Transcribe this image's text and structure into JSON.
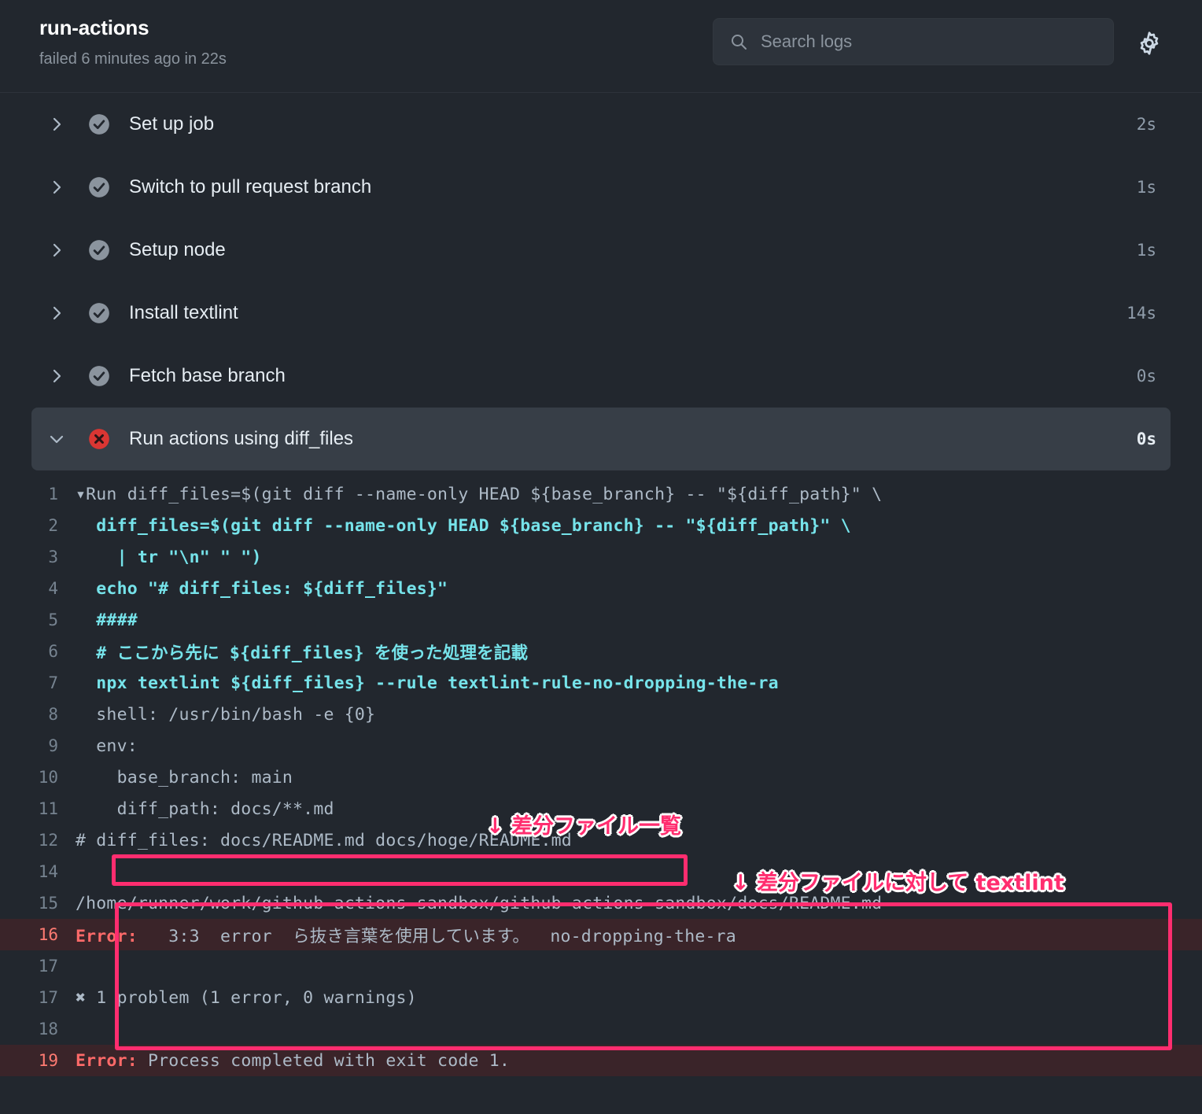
{
  "header": {
    "title": "run-actions",
    "subtitle": "failed 6 minutes ago in 22s",
    "search_placeholder": "Search logs",
    "search_value": "",
    "search_icon": "search-icon",
    "settings_icon": "gear-icon"
  },
  "steps": [
    {
      "label": "Set up job",
      "duration": "2s",
      "status": "success",
      "expanded": false,
      "chevron": "chevron-right-icon"
    },
    {
      "label": "Switch to pull request branch",
      "duration": "1s",
      "status": "success",
      "expanded": false,
      "chevron": "chevron-right-icon"
    },
    {
      "label": "Setup node",
      "duration": "1s",
      "status": "success",
      "expanded": false,
      "chevron": "chevron-right-icon"
    },
    {
      "label": "Install textlint",
      "duration": "14s",
      "status": "success",
      "expanded": false,
      "chevron": "chevron-right-icon"
    },
    {
      "label": "Fetch base branch",
      "duration": "0s",
      "status": "success",
      "expanded": false,
      "chevron": "chevron-right-icon"
    },
    {
      "label": "Run actions using diff_files",
      "duration": "0s",
      "status": "failure",
      "expanded": true,
      "chevron": "chevron-down-icon"
    }
  ],
  "log_lines": [
    {
      "num": "1",
      "text": "▾Run diff_files=$(git diff --name-only HEAD ${base_branch} -- \"${diff_path}\" \\",
      "style": "plain"
    },
    {
      "num": "2",
      "text": "  diff_files=$(git diff --name-only HEAD ${base_branch} -- \"${diff_path}\" \\",
      "style": "cyan"
    },
    {
      "num": "3",
      "text": "    | tr \"\\n\" \" \")",
      "style": "cyan"
    },
    {
      "num": "4",
      "text": "  echo \"# diff_files: ${diff_files}\"",
      "style": "cyan"
    },
    {
      "num": "5",
      "text": "  ####",
      "style": "cyan"
    },
    {
      "num": "6",
      "text": "  # ここから先に ${diff_files} を使った処理を記載",
      "style": "cyan"
    },
    {
      "num": "7",
      "text": "  npx textlint ${diff_files} --rule textlint-rule-no-dropping-the-ra",
      "style": "cyan"
    },
    {
      "num": "8",
      "text": "  shell: /usr/bin/bash -e {0}",
      "style": "plain"
    },
    {
      "num": "9",
      "text": "  env:",
      "style": "plain"
    },
    {
      "num": "10",
      "text": "    base_branch: main",
      "style": "plain"
    },
    {
      "num": "11",
      "text": "    diff_path: docs/**.md",
      "style": "plain"
    },
    {
      "num": "12",
      "text": "# diff_files: docs/README.md docs/hoge/README.md",
      "style": "plain"
    },
    {
      "num": "14",
      "text": "",
      "style": "plain"
    },
    {
      "num": "15",
      "text": "/home/runner/work/github-actions-sandbox/github-actions-sandbox/docs/README.md",
      "style": "plain"
    },
    {
      "num": "16",
      "text": "   3:3  error  ら抜き言葉を使用しています。  no-dropping-the-ra",
      "style": "error",
      "error_prefix": "Error:"
    },
    {
      "num": "17",
      "text": "",
      "style": "plain"
    },
    {
      "num": "17",
      "text": "✖ 1 problem (1 error, 0 warnings)",
      "style": "plain"
    },
    {
      "num": "18",
      "text": "",
      "style": "plain"
    },
    {
      "num": "19",
      "text": " Process completed with exit code 1.",
      "style": "error",
      "error_prefix": "Error:"
    }
  ],
  "annotations": {
    "diff_files_label": "↓ 差分ファイル一覧",
    "textlint_label": "↓ 差分ファイルに対して textlint",
    "accent_color": "#ff2d6f"
  },
  "colors": {
    "background": "#22272e",
    "active_row": "#373e47",
    "error_row": "#3a2429",
    "success_icon": "#768390",
    "failure_icon": "#da3633",
    "code_cyan": "#76e3ea",
    "code_plain": "#adbac7",
    "error_text": "#ff6a69"
  }
}
